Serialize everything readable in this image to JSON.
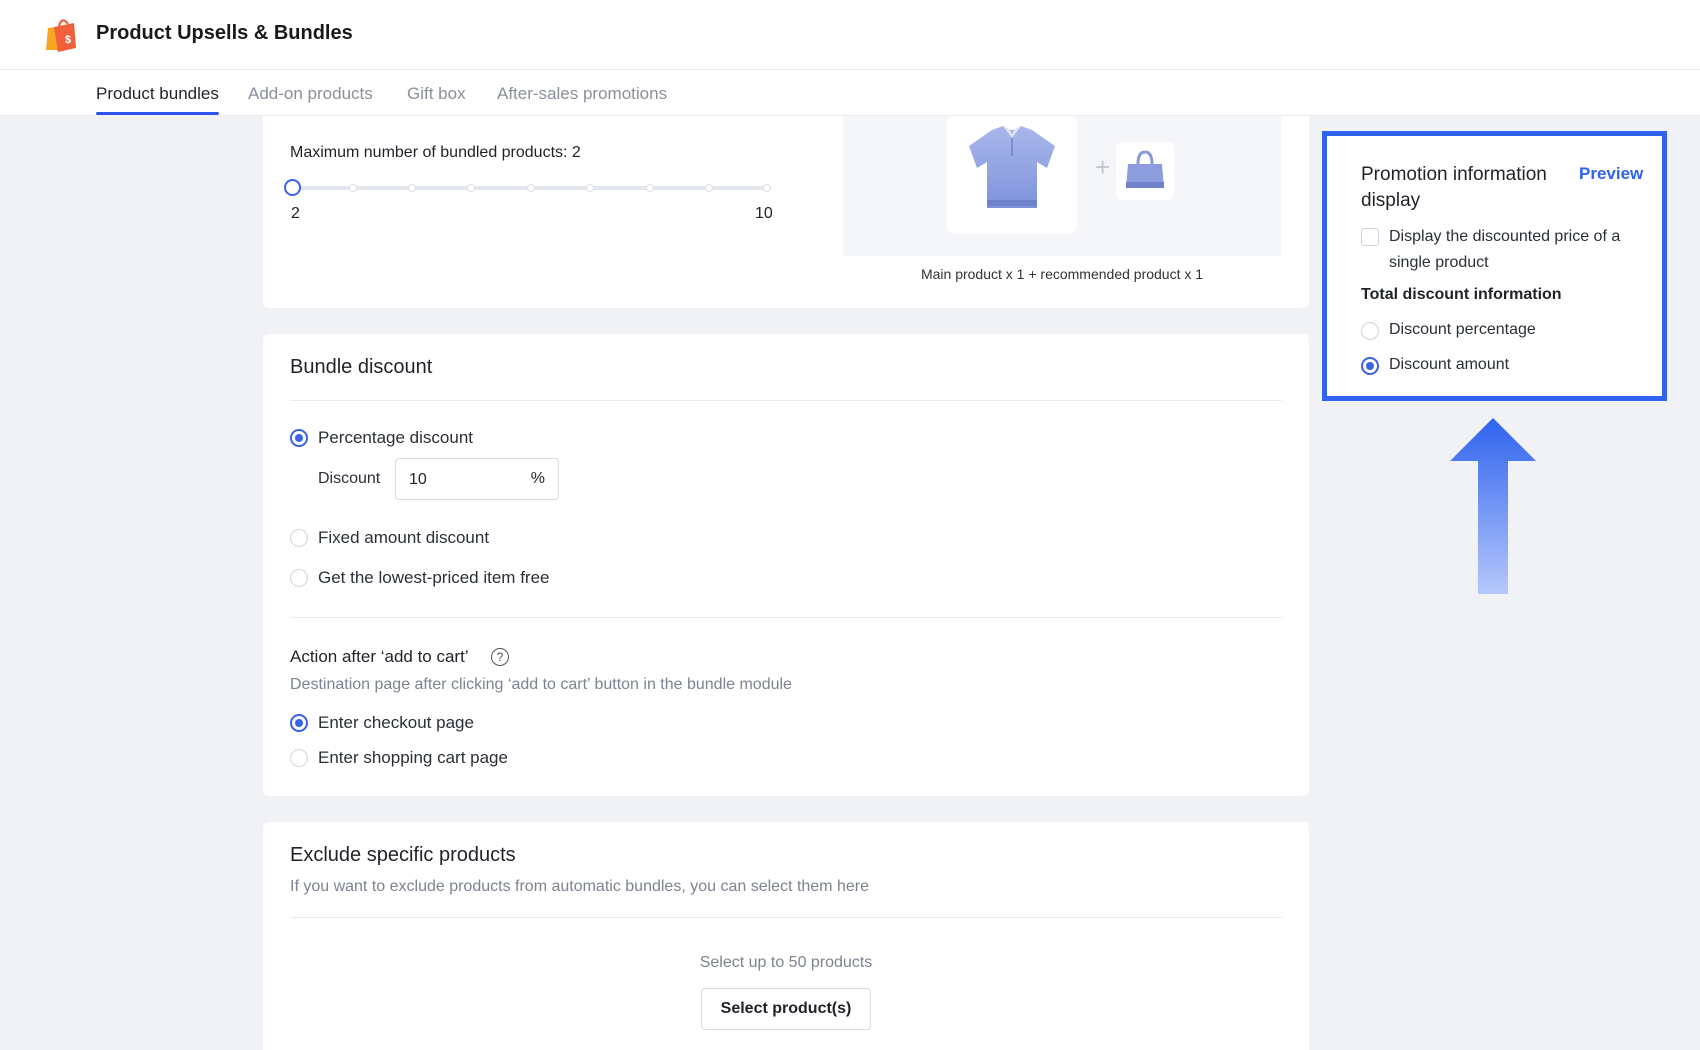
{
  "app": {
    "title": "Product Upsells & Bundles"
  },
  "tabs": [
    {
      "label": "Product bundles",
      "active": true
    },
    {
      "label": "Add-on products",
      "active": false
    },
    {
      "label": "Gift box",
      "active": false
    },
    {
      "label": "After-sales promotions",
      "active": false
    }
  ],
  "bundle_size": {
    "label": "Maximum number of bundled products: 2",
    "min": "2",
    "max": "10",
    "value": 2,
    "preview_caption": "Main product x 1 + recommended product x 1"
  },
  "bundle_discount": {
    "title": "Bundle discount",
    "options": [
      {
        "label": "Percentage discount",
        "checked": true
      },
      {
        "label": "Fixed amount discount",
        "checked": false
      },
      {
        "label": "Get the lowest-priced item free",
        "checked": false
      }
    ],
    "discount_field": {
      "label": "Discount",
      "value": "10",
      "suffix": "%"
    },
    "action": {
      "title": "Action after ‘add to cart’",
      "description": "Destination page after clicking ‘add to cart’ button in the bundle module",
      "options": [
        {
          "label": "Enter checkout page",
          "checked": true
        },
        {
          "label": "Enter shopping cart page",
          "checked": false
        }
      ]
    }
  },
  "exclude": {
    "title": "Exclude specific products",
    "description": "If you want to exclude products from automatic bundles, you can select them here",
    "hint": "Select up to 50 products",
    "button": "Select product(s)"
  },
  "promotion_panel": {
    "title": "Promotion information display",
    "preview_link": "Preview",
    "checkbox_label": "Display the discounted price of a single product",
    "subheading": "Total discount information",
    "options": [
      {
        "label": "Discount percentage",
        "checked": false
      },
      {
        "label": "Discount amount",
        "checked": true
      }
    ]
  },
  "colors": {
    "accent": "#2f63ee",
    "logo": "#f0603a"
  },
  "icons": [
    "shopping-bag-logo-icon",
    "shirt-icon",
    "handbag-icon",
    "plus-icon",
    "help-icon",
    "up-arrow-icon"
  ]
}
